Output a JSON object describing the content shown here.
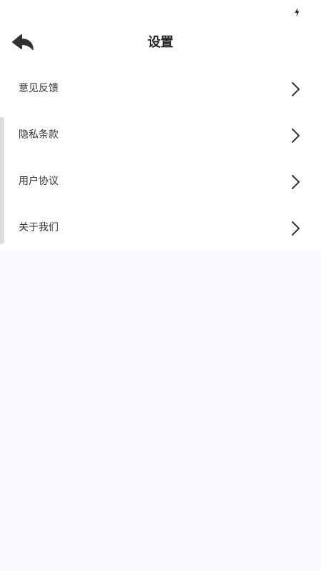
{
  "status_bar": {
    "icons": [
      "charging-icon"
    ]
  },
  "header": {
    "back_icon": "back-arrow-icon",
    "title": "设置"
  },
  "menu": {
    "items": [
      {
        "label": "意见反馈",
        "icon": "chevron-right-icon"
      },
      {
        "label": "隐私条款",
        "icon": "chevron-right-icon"
      },
      {
        "label": "用户协议",
        "icon": "chevron-right-icon"
      },
      {
        "label": "关于我们",
        "icon": "chevron-right-icon"
      }
    ]
  },
  "colors": {
    "page_background": "#faf9fe",
    "surface": "#ffffff",
    "text_primary": "#222222",
    "icon": "#333333"
  }
}
